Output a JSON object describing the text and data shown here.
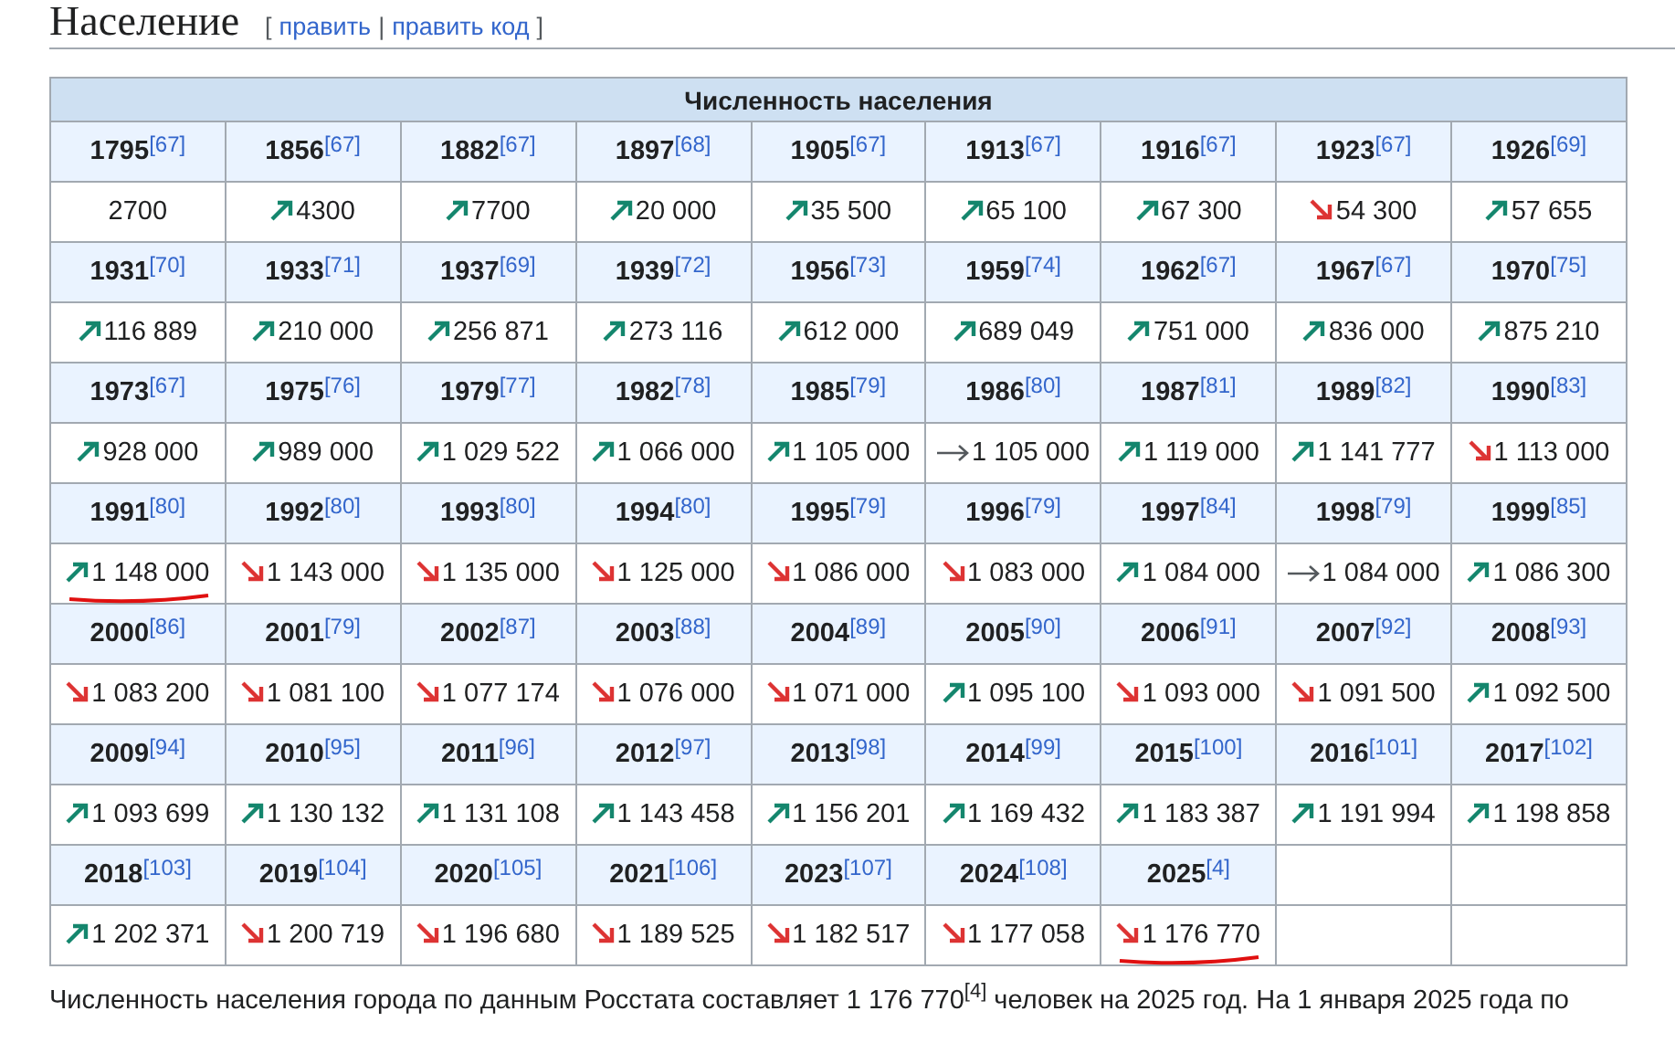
{
  "heading": {
    "title": "Население",
    "open": "[",
    "links": [
      "править",
      "править код"
    ],
    "separator": "|",
    "close": "]"
  },
  "table": {
    "caption": "Численность населения",
    "cells": [
      {
        "year": "1795",
        "ref": "[67]",
        "kind": "plain",
        "value": "2700",
        "underlined": false
      },
      {
        "year": "1856",
        "ref": "[67]",
        "kind": "up",
        "value": "4300",
        "underlined": false
      },
      {
        "year": "1882",
        "ref": "[67]",
        "kind": "up",
        "value": "7700",
        "underlined": false
      },
      {
        "year": "1897",
        "ref": "[68]",
        "kind": "up",
        "value": "20 000",
        "underlined": false
      },
      {
        "year": "1905",
        "ref": "[67]",
        "kind": "up",
        "value": "35 500",
        "underlined": false
      },
      {
        "year": "1913",
        "ref": "[67]",
        "kind": "up",
        "value": "65 100",
        "underlined": false
      },
      {
        "year": "1916",
        "ref": "[67]",
        "kind": "up",
        "value": "67 300",
        "underlined": false
      },
      {
        "year": "1923",
        "ref": "[67]",
        "kind": "down",
        "value": "54 300",
        "underlined": false
      },
      {
        "year": "1926",
        "ref": "[69]",
        "kind": "up",
        "value": "57 655",
        "underlined": false
      },
      {
        "year": "1931",
        "ref": "[70]",
        "kind": "up",
        "value": "116 889",
        "underlined": false
      },
      {
        "year": "1933",
        "ref": "[71]",
        "kind": "up",
        "value": "210 000",
        "underlined": false
      },
      {
        "year": "1937",
        "ref": "[69]",
        "kind": "up",
        "value": "256 871",
        "underlined": false
      },
      {
        "year": "1939",
        "ref": "[72]",
        "kind": "up",
        "value": "273 116",
        "underlined": false
      },
      {
        "year": "1956",
        "ref": "[73]",
        "kind": "up",
        "value": "612 000",
        "underlined": false
      },
      {
        "year": "1959",
        "ref": "[74]",
        "kind": "up",
        "value": "689 049",
        "underlined": false
      },
      {
        "year": "1962",
        "ref": "[67]",
        "kind": "up",
        "value": "751 000",
        "underlined": false
      },
      {
        "year": "1967",
        "ref": "[67]",
        "kind": "up",
        "value": "836 000",
        "underlined": false
      },
      {
        "year": "1970",
        "ref": "[75]",
        "kind": "up",
        "value": "875 210",
        "underlined": false
      },
      {
        "year": "1973",
        "ref": "[67]",
        "kind": "up",
        "value": "928 000",
        "underlined": false
      },
      {
        "year": "1975",
        "ref": "[76]",
        "kind": "up",
        "value": "989 000",
        "underlined": false
      },
      {
        "year": "1979",
        "ref": "[77]",
        "kind": "up",
        "value": "1 029 522",
        "underlined": false
      },
      {
        "year": "1982",
        "ref": "[78]",
        "kind": "up",
        "value": "1 066 000",
        "underlined": false
      },
      {
        "year": "1985",
        "ref": "[79]",
        "kind": "up",
        "value": "1 105 000",
        "underlined": false
      },
      {
        "year": "1986",
        "ref": "[80]",
        "kind": "flat",
        "value": "1 105 000",
        "underlined": false
      },
      {
        "year": "1987",
        "ref": "[81]",
        "kind": "up",
        "value": "1 119 000",
        "underlined": false
      },
      {
        "year": "1989",
        "ref": "[82]",
        "kind": "up",
        "value": "1 141 777",
        "underlined": false
      },
      {
        "year": "1990",
        "ref": "[83]",
        "kind": "down",
        "value": "1 113 000",
        "underlined": false
      },
      {
        "year": "1991",
        "ref": "[80]",
        "kind": "up",
        "value": "1 148 000",
        "underlined": true
      },
      {
        "year": "1992",
        "ref": "[80]",
        "kind": "down",
        "value": "1 143 000",
        "underlined": false
      },
      {
        "year": "1993",
        "ref": "[80]",
        "kind": "down",
        "value": "1 135 000",
        "underlined": false
      },
      {
        "year": "1994",
        "ref": "[80]",
        "kind": "down",
        "value": "1 125 000",
        "underlined": false
      },
      {
        "year": "1995",
        "ref": "[79]",
        "kind": "down",
        "value": "1 086 000",
        "underlined": false
      },
      {
        "year": "1996",
        "ref": "[79]",
        "kind": "down",
        "value": "1 083 000",
        "underlined": false
      },
      {
        "year": "1997",
        "ref": "[84]",
        "kind": "up",
        "value": "1 084 000",
        "underlined": false
      },
      {
        "year": "1998",
        "ref": "[79]",
        "kind": "flat",
        "value": "1 084 000",
        "underlined": false
      },
      {
        "year": "1999",
        "ref": "[85]",
        "kind": "up",
        "value": "1 086 300",
        "underlined": false
      },
      {
        "year": "2000",
        "ref": "[86]",
        "kind": "down",
        "value": "1 083 200",
        "underlined": false
      },
      {
        "year": "2001",
        "ref": "[79]",
        "kind": "down",
        "value": "1 081 100",
        "underlined": false
      },
      {
        "year": "2002",
        "ref": "[87]",
        "kind": "down",
        "value": "1 077 174",
        "underlined": false
      },
      {
        "year": "2003",
        "ref": "[88]",
        "kind": "down",
        "value": "1 076 000",
        "underlined": false
      },
      {
        "year": "2004",
        "ref": "[89]",
        "kind": "down",
        "value": "1 071 000",
        "underlined": false
      },
      {
        "year": "2005",
        "ref": "[90]",
        "kind": "up",
        "value": "1 095 100",
        "underlined": false
      },
      {
        "year": "2006",
        "ref": "[91]",
        "kind": "down",
        "value": "1 093 000",
        "underlined": false
      },
      {
        "year": "2007",
        "ref": "[92]",
        "kind": "down",
        "value": "1 091 500",
        "underlined": false
      },
      {
        "year": "2008",
        "ref": "[93]",
        "kind": "up",
        "value": "1 092 500",
        "underlined": false
      },
      {
        "year": "2009",
        "ref": "[94]",
        "kind": "up",
        "value": "1 093 699",
        "underlined": false
      },
      {
        "year": "2010",
        "ref": "[95]",
        "kind": "up",
        "value": "1 130 132",
        "underlined": false
      },
      {
        "year": "2011",
        "ref": "[96]",
        "kind": "up",
        "value": "1 131 108",
        "underlined": false
      },
      {
        "year": "2012",
        "ref": "[97]",
        "kind": "up",
        "value": "1 143 458",
        "underlined": false
      },
      {
        "year": "2013",
        "ref": "[98]",
        "kind": "up",
        "value": "1 156 201",
        "underlined": false
      },
      {
        "year": "2014",
        "ref": "[99]",
        "kind": "up",
        "value": "1 169 432",
        "underlined": false
      },
      {
        "year": "2015",
        "ref": "[100]",
        "kind": "up",
        "value": "1 183 387",
        "underlined": false
      },
      {
        "year": "2016",
        "ref": "[101]",
        "kind": "up",
        "value": "1 191 994",
        "underlined": false
      },
      {
        "year": "2017",
        "ref": "[102]",
        "kind": "up",
        "value": "1 198 858",
        "underlined": false
      },
      {
        "year": "2018",
        "ref": "[103]",
        "kind": "up",
        "value": "1 202 371",
        "underlined": false
      },
      {
        "year": "2019",
        "ref": "[104]",
        "kind": "down",
        "value": "1 200 719",
        "underlined": false
      },
      {
        "year": "2020",
        "ref": "[105]",
        "kind": "down",
        "value": "1 196 680",
        "underlined": false
      },
      {
        "year": "2021",
        "ref": "[106]",
        "kind": "down",
        "value": "1 189 525",
        "underlined": false
      },
      {
        "year": "2023",
        "ref": "[107]",
        "kind": "down",
        "value": "1 182 517",
        "underlined": false
      },
      {
        "year": "2024",
        "ref": "[108]",
        "kind": "down",
        "value": "1 177 058",
        "underlined": false
      },
      {
        "year": "2025",
        "ref": "[4]",
        "kind": "down",
        "value": "1 176 770",
        "underlined": true
      }
    ]
  },
  "paragraph": "Численность населения города по данным Росстата составляет 1 176 770$^{[4]}$ человек на 2025 год. На 1 января 2025 года по"
}
